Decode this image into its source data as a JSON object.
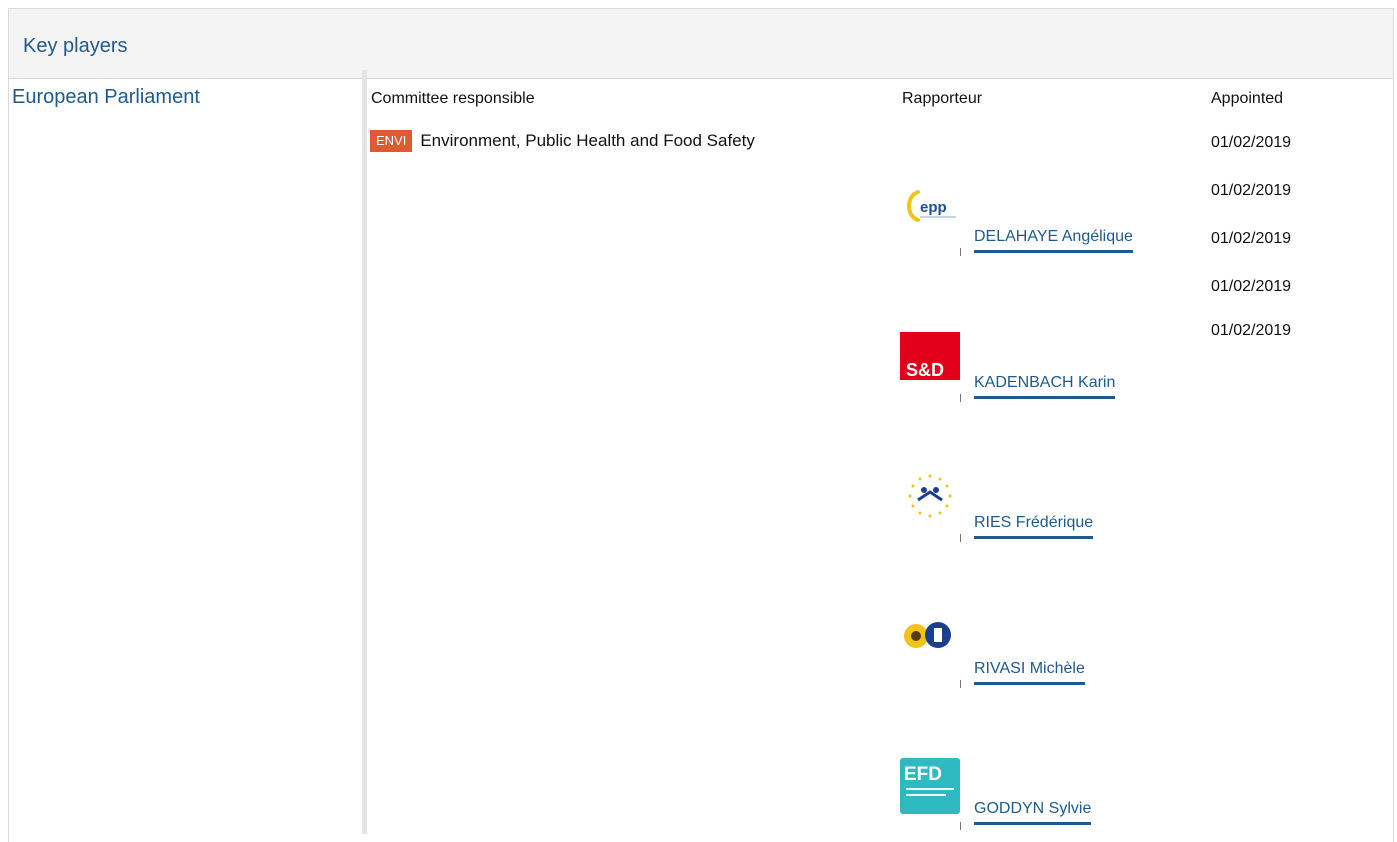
{
  "section": {
    "title": "Key players"
  },
  "institution": "European Parliament",
  "columns": {
    "committee": "Committee responsible",
    "rapporteur": "Rapporteur",
    "appointed": "Appointed"
  },
  "committee": {
    "code": "ENVI",
    "name": "Environment, Public Health and Food Safety",
    "badge_color": "#dd5b2c"
  },
  "dates": [
    "01/02/2019",
    "01/02/2019",
    "01/02/2019",
    "01/02/2019",
    "01/02/2019"
  ],
  "rapporteurs": [
    {
      "name": "DELAHAYE Angélique",
      "group_logo": "epp-logo",
      "group_label": "epp"
    },
    {
      "name": "KADENBACH Karin",
      "group_logo": "sd-logo",
      "group_label": "S&D"
    },
    {
      "name": "RIES Frédérique",
      "group_logo": "renew-stars-logo",
      "group_label": ""
    },
    {
      "name": "RIVASI Michèle",
      "group_logo": "greens-efa-logo",
      "group_label": ""
    },
    {
      "name": "GODDYN Sylvie",
      "group_logo": "efd-logo",
      "group_label": "EFD"
    }
  ],
  "colors": {
    "link": "#1f5a8f",
    "header_bg": "#f4f4f4"
  }
}
